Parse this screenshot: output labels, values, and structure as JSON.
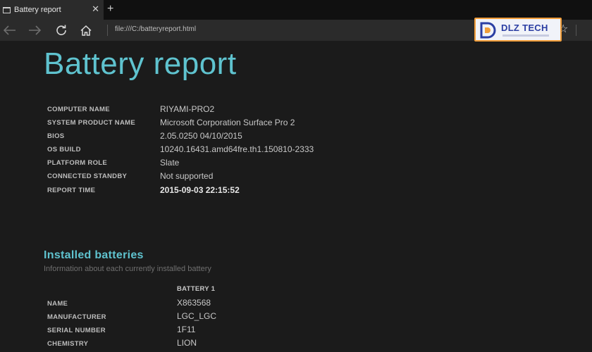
{
  "browser": {
    "tab": {
      "title": "Battery report",
      "close_glyph": "✕"
    },
    "new_tab_glyph": "+",
    "address": "file:///C:/batteryreport.html",
    "favorite_glyph": "☆",
    "icons": [
      "tab-page-icon",
      "back-icon",
      "forward-icon",
      "refresh-icon",
      "home-icon",
      "favorite-star-icon"
    ]
  },
  "watermark": {
    "text": "DLZ TECH",
    "border_color": "#f29e3a",
    "text_color": "#2b3ea3"
  },
  "report": {
    "title": "Battery report",
    "title_color": "#5fc3cf",
    "system_info": [
      {
        "label": "COMPUTER NAME",
        "value": "RIYAMI-PRO2"
      },
      {
        "label": "SYSTEM PRODUCT NAME",
        "value": "Microsoft Corporation Surface Pro 2"
      },
      {
        "label": "BIOS",
        "value": "2.05.0250 04/10/2015"
      },
      {
        "label": "OS BUILD",
        "value": "10240.16431.amd64fre.th1.150810-2333"
      },
      {
        "label": "PLATFORM ROLE",
        "value": "Slate"
      },
      {
        "label": "CONNECTED STANDBY",
        "value": "Not supported"
      },
      {
        "label": "REPORT TIME",
        "value": "2015-09-03  22:15:52"
      }
    ],
    "installed": {
      "title": "Installed batteries",
      "subtitle": "Information about each currently installed battery",
      "column_header": "BATTERY 1",
      "rows": [
        {
          "label": "NAME",
          "value": "X863568"
        },
        {
          "label": "MANUFACTURER",
          "value": "LGC_LGC"
        },
        {
          "label": "SERIAL NUMBER",
          "value": "1F11"
        },
        {
          "label": "CHEMISTRY",
          "value": "LION"
        }
      ]
    }
  }
}
